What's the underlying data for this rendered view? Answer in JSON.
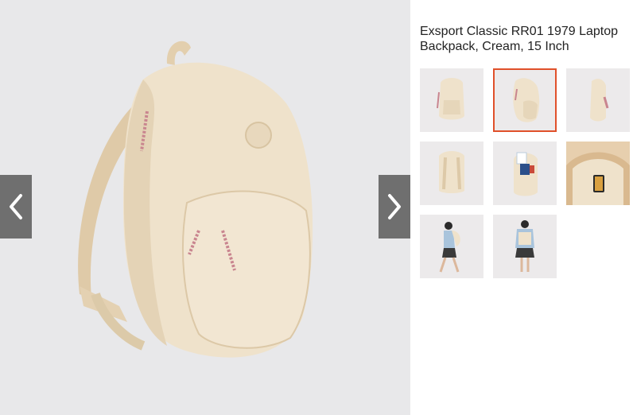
{
  "product": {
    "title": "Exsport Classic RR01 1979 Laptop Backpack, Cream, 15 Inch"
  },
  "main_image": {
    "icon": "cream-backpack-image"
  },
  "navigation": {
    "prev_icon": "chevron-left-icon",
    "next_icon": "chevron-right-icon"
  },
  "thumbnails": [
    {
      "icon": "backpack-front-thumb",
      "selected": false
    },
    {
      "icon": "backpack-angle-thumb",
      "selected": true
    },
    {
      "icon": "backpack-side-thumb",
      "selected": false
    },
    {
      "icon": "backpack-back-thumb",
      "selected": false
    },
    {
      "icon": "backpack-open-thumb",
      "selected": false
    },
    {
      "icon": "backpack-interior-thumb",
      "selected": false
    },
    {
      "icon": "model-walking-thumb",
      "selected": false
    },
    {
      "icon": "model-front-thumb",
      "selected": false
    }
  ],
  "colors": {
    "backpack": "#ecdcc2",
    "selected_border": "#e0502a",
    "nav_button": "#6f6f6f"
  }
}
